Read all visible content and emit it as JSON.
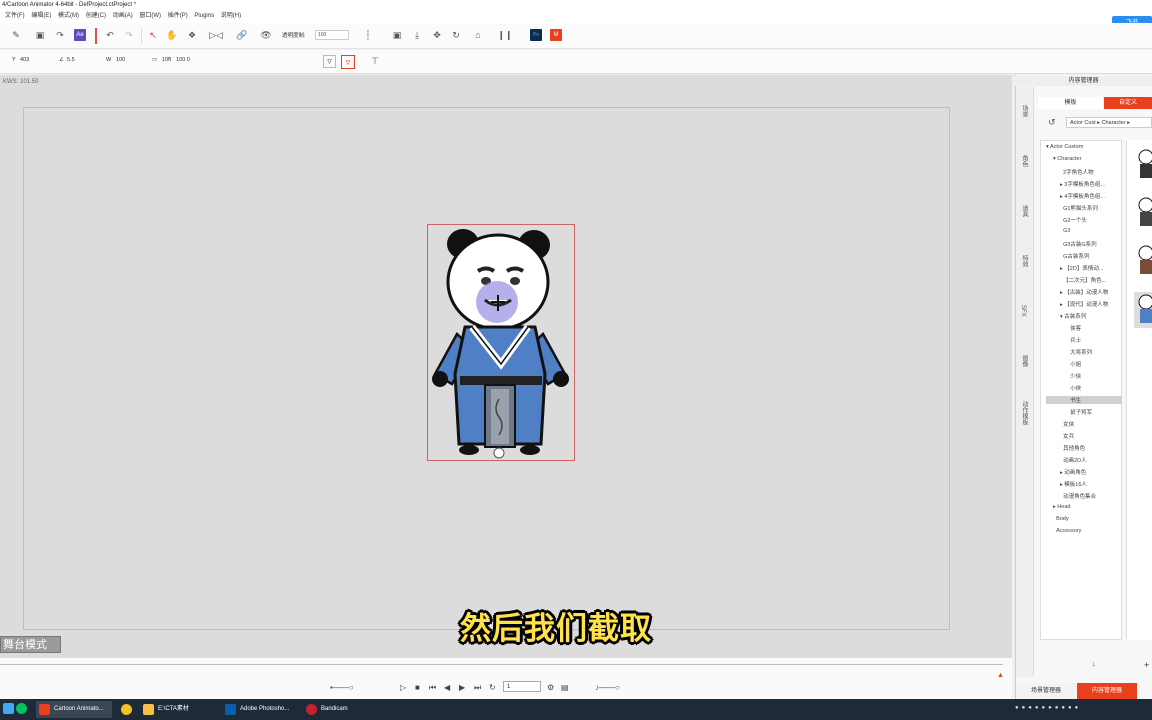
{
  "window": {
    "title": "4/Cartoon Animator 4-64bit - DefProject.ctProject *"
  },
  "menu": [
    "文件(F)",
    "编辑(E)",
    "模式(M)",
    "创建(C)",
    "动画(A)",
    "窗口(W)",
    "插件(P)",
    "Plugins",
    "说明(H)"
  ],
  "toolbar": {
    "opacity_label": "透明度制:",
    "opacity_value": "100"
  },
  "transform": {
    "y_label": "Y",
    "y_value": "403",
    "angle_label": "∠",
    "angle_value": "5.5",
    "w_label": "W",
    "w_value": "100",
    "h_label": "▭",
    "h_value": "100",
    "o_label": "°",
    "o_value": "100.0"
  },
  "canvas": {
    "coord_label": "KWS: 101.50",
    "mode_button": "舞台模式",
    "subtitle": "然后我们截取"
  },
  "playback": {
    "frame_value": "1"
  },
  "right_panel": {
    "title": "内容管理器",
    "tab_template": "模板",
    "tab_custom": "自定义",
    "path": [
      "Actor Cust",
      "Character",
      ""
    ],
    "vtabs": [
      "场景",
      "角色",
      "道具",
      "特效",
      "SFX",
      "图像",
      "动作模板"
    ],
    "tree": [
      {
        "label": "Actor Custom",
        "indent": 0,
        "arrow": "▾"
      },
      {
        "label": "Character",
        "indent": 1,
        "arrow": "▾"
      },
      {
        "label": "2字角色人物",
        "indent": 2,
        "arrow": ""
      },
      {
        "label": "3字模板角色组...",
        "indent": 2,
        "arrow": "▸"
      },
      {
        "label": "4字模板角色组...",
        "indent": 2,
        "arrow": "▸"
      },
      {
        "label": "G1熊猫头系列",
        "indent": 2,
        "arrow": ""
      },
      {
        "label": "G2一个头",
        "indent": 2,
        "arrow": ""
      },
      {
        "label": "G3",
        "indent": 2,
        "arrow": ""
      },
      {
        "label": "G3古装G系列",
        "indent": 2,
        "arrow": ""
      },
      {
        "label": "G古装系列",
        "indent": 2,
        "arrow": ""
      },
      {
        "label": "【2D】表情动...",
        "indent": 2,
        "arrow": "▸"
      },
      {
        "label": "【二次元】角色...",
        "indent": 2,
        "arrow": ""
      },
      {
        "label": "【古装】动漫人物",
        "indent": 2,
        "arrow": "▸"
      },
      {
        "label": "【现代】动漫人物",
        "indent": 2,
        "arrow": "▸"
      },
      {
        "label": "古装系列",
        "indent": 2,
        "arrow": "▾"
      },
      {
        "label": "侠客",
        "indent": 3,
        "arrow": ""
      },
      {
        "label": "兵士",
        "indent": 3,
        "arrow": ""
      },
      {
        "label": "大将系列",
        "indent": 3,
        "arrow": ""
      },
      {
        "label": "小姐",
        "indent": 3,
        "arrow": ""
      },
      {
        "label": "少侠",
        "indent": 3,
        "arrow": ""
      },
      {
        "label": "小俠",
        "indent": 3,
        "arrow": ""
      },
      {
        "label": "书生",
        "indent": 3,
        "arrow": "",
        "selected": true
      },
      {
        "label": "鼠子将军",
        "indent": 3,
        "arrow": ""
      },
      {
        "label": "女侠",
        "indent": 2,
        "arrow": ""
      },
      {
        "label": "女兵",
        "indent": 2,
        "arrow": ""
      },
      {
        "label": "其他角色",
        "indent": 2,
        "arrow": ""
      },
      {
        "label": "动画2D人",
        "indent": 2,
        "arrow": ""
      },
      {
        "label": "动画角色",
        "indent": 2,
        "arrow": "▸"
      },
      {
        "label": "模板16人",
        "indent": 2,
        "arrow": "▸"
      },
      {
        "label": "动漫角色集合",
        "indent": 2,
        "arrow": ""
      },
      {
        "label": "Head",
        "indent": 1,
        "arrow": "▸"
      },
      {
        "label": "Body",
        "indent": 1,
        "arrow": ""
      },
      {
        "label": "Accessory",
        "indent": 1,
        "arrow": ""
      }
    ],
    "bottom_tab1": "场景管理器",
    "bottom_tab2": "内容管理器"
  },
  "feishu": "飞书",
  "taskbar": [
    {
      "label": "Cartoon Animato...",
      "color": "#e8401c"
    },
    {
      "label": "",
      "color": "#ffffff"
    },
    {
      "label": "E:\\CTA素材",
      "color": "#f3c14b"
    },
    {
      "label": "Adobe Photosho...",
      "color": "#0a5fa8"
    },
    {
      "label": "Bandicam",
      "color": "#c4232b"
    }
  ],
  "colors": {
    "accent": "#e8401c",
    "costume_blue": "#4f7fc4",
    "subtitle_yellow": "#ffe14a"
  }
}
